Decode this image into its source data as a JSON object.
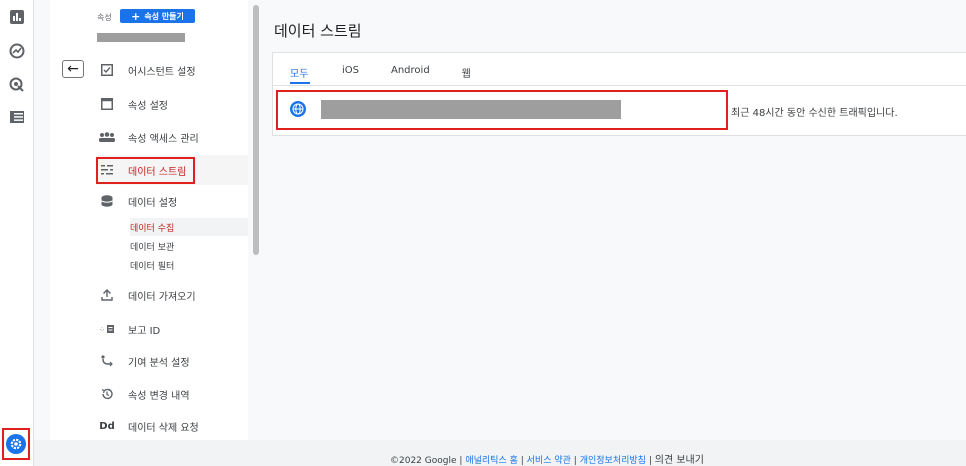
{
  "colors": {
    "accent": "#1a73e8",
    "highlight": "#e0201c",
    "active_text": "#c5221f"
  },
  "rail": {
    "icons": [
      "bar-chart-icon",
      "explore-icon",
      "advertising-icon",
      "list-icon"
    ],
    "settings_icon": "gear-icon"
  },
  "admin": {
    "property_label": "속성",
    "create_property_label": "속성 만들기",
    "nav": [
      {
        "label": "어시스턴트 설정",
        "icon": "checklist-icon"
      },
      {
        "label": "속성 설정",
        "icon": "window-icon"
      },
      {
        "label": "속성 액세스 관리",
        "icon": "people-icon"
      },
      {
        "label": "데이터 스트림",
        "icon": "streams-icon",
        "active": true
      },
      {
        "label": "데이터 설정",
        "icon": "database-icon"
      },
      {
        "label": "데이터 가져오기",
        "icon": "upload-icon"
      },
      {
        "label": "보고 ID",
        "icon": "reporting-id-icon"
      },
      {
        "label": "기여 분석 설정",
        "icon": "attribution-icon"
      },
      {
        "label": "속성 변경 내역",
        "icon": "history-icon"
      },
      {
        "label": "데이터 삭제 요청",
        "icon": "dd-icon"
      }
    ],
    "sub_items": [
      {
        "label": "데이터 수집",
        "active": true
      },
      {
        "label": "데이터 보관"
      },
      {
        "label": "데이터 필터"
      }
    ]
  },
  "main": {
    "title": "데이터 스트림",
    "tabs": [
      {
        "label": "모두",
        "active": true
      },
      {
        "label": "iOS"
      },
      {
        "label": "Android"
      },
      {
        "label": "웹"
      }
    ],
    "stream": {
      "status": "최근 48시간 동안 수신한 트래픽입니다."
    }
  },
  "footer": {
    "copyright": "©2022 Google",
    "links": [
      "애널리틱스 홈",
      "서비스 약관",
      "개인정보처리방침"
    ],
    "separator": "|",
    "feedback": "의견 보내기"
  }
}
